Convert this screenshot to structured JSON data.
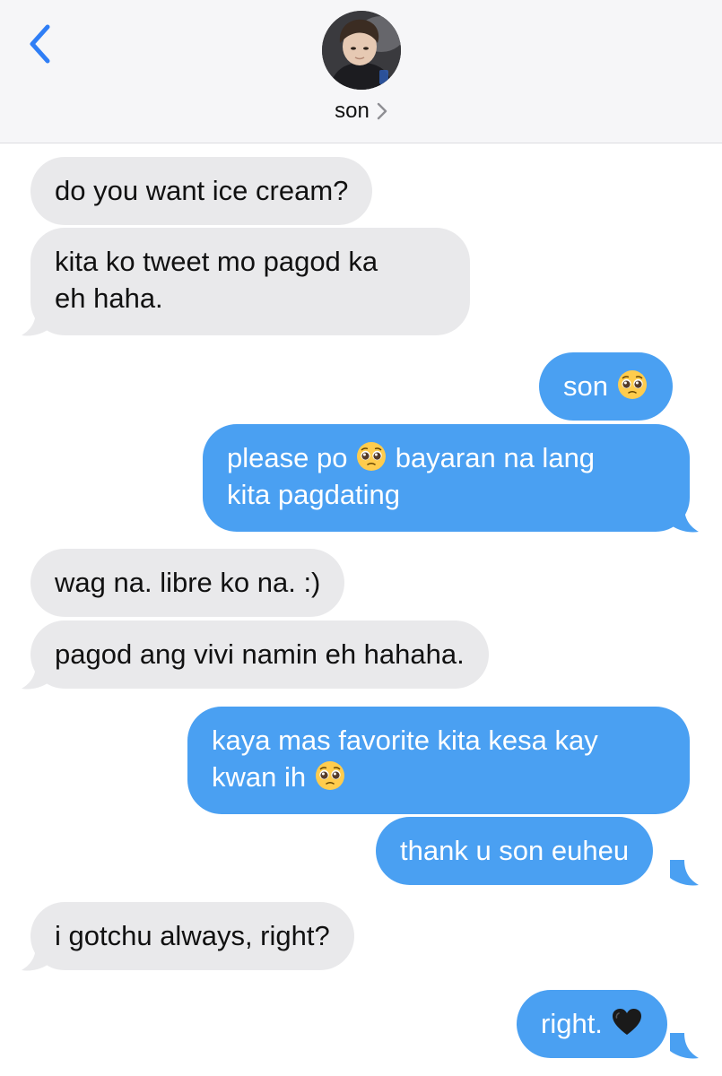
{
  "header": {
    "contact_name": "son",
    "back_icon": "chevron-left-icon",
    "name_chevron_icon": "chevron-right-icon",
    "accent_color": "#2f7ef6"
  },
  "colors": {
    "incoming_bubble": "#e9e9eb",
    "outgoing_bubble": "#4aa0f2",
    "header_bg": "#f6f6f8"
  },
  "messages": [
    {
      "from": "contact",
      "text": "do you want ice cream?"
    },
    {
      "from": "contact",
      "lines": [
        "kita ko tweet mo pagod ka",
        "eh haha."
      ]
    },
    {
      "from": "me",
      "text": "son",
      "emoji": "pleading-face"
    },
    {
      "from": "me",
      "line1_a": "please po",
      "line1_b": "bayaran na lang",
      "line2": "kita pagdating",
      "emoji": "pleading-face"
    },
    {
      "from": "contact",
      "text": "wag na. libre ko na. :)"
    },
    {
      "from": "contact",
      "text": "pagod ang vivi namin eh hahaha."
    },
    {
      "from": "me",
      "line1": "kaya mas favorite kita kesa kay",
      "line2": "kwan ih",
      "emoji": "pleading-face"
    },
    {
      "from": "me",
      "text": "thank u son euheu"
    },
    {
      "from": "contact",
      "text": "i gotchu always, right?"
    },
    {
      "from": "me",
      "text": "right.",
      "emoji": "black-heart"
    }
  ]
}
